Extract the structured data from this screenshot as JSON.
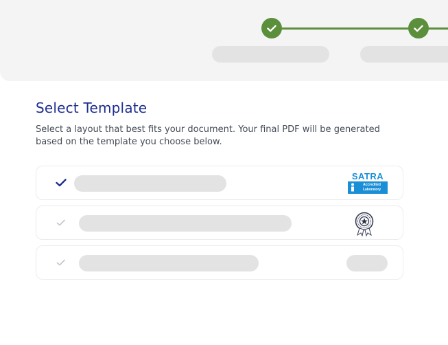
{
  "stepper": {
    "steps": [
      {
        "status": "complete",
        "icon": "check-icon"
      },
      {
        "status": "complete",
        "icon": "check-icon"
      }
    ],
    "accent_color": "#5b8f3b"
  },
  "template_section": {
    "title": "Select Template",
    "description": "Select a layout that best fits your document. Your final PDF will be generated based on the template you choose below."
  },
  "options": [
    {
      "selected": true,
      "badge": "satra-accredited-laboratory-logo"
    },
    {
      "selected": false,
      "badge": "seal-emblem-logo"
    },
    {
      "selected": false,
      "badge": "placeholder-pill"
    }
  ],
  "logos": {
    "satra": {
      "name": "SATRA",
      "line1": "Accredited",
      "line2": "Laboratory"
    }
  },
  "colors": {
    "title": "#1f2f8f",
    "check_selected": "#1f2f8f",
    "check_unselected": "#c4c8d0",
    "placeholder": "#e3e3e3"
  }
}
